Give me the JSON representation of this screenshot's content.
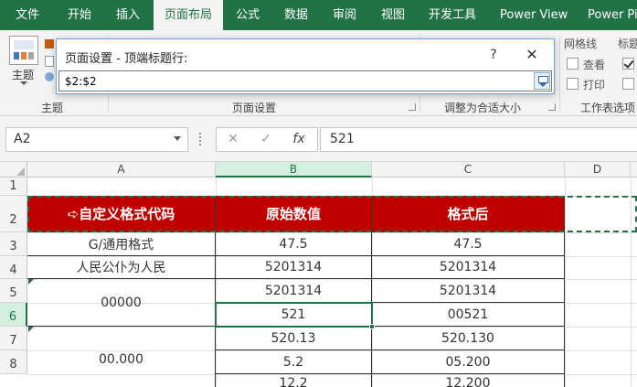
{
  "ribbon": {
    "tabs": [
      "文件",
      "开始",
      "插入",
      "页面布局",
      "公式",
      "数据",
      "审阅",
      "视图",
      "开发工具",
      "Power View",
      "Power Pi"
    ],
    "active_tab": "页面布局",
    "groups": {
      "theme": "主题",
      "theme_button": "主题",
      "page_setup": "页面设置",
      "scale_to_fit": "调整为合适大小",
      "sheet_options": "工作表选项"
    },
    "sheet_options": {
      "gridlines": "网格线",
      "headings": "标题",
      "view": "查看",
      "print": "打印"
    }
  },
  "dialog": {
    "title": "页面设置 - 顶端标题行:",
    "help": "?",
    "close": "✕",
    "value": "$2:$2"
  },
  "formula_bar": {
    "name_box": "A2",
    "cancel": "✕",
    "enter": "✓",
    "fx": "fx",
    "formula": "521"
  },
  "sheet": {
    "columns": [
      "A",
      "B",
      "C",
      "D"
    ],
    "rows": [
      "1",
      "2",
      "3",
      "4",
      "5",
      "6",
      "7",
      "8"
    ],
    "header": [
      "➪自定义格式代码",
      "原始数值",
      "格式后"
    ],
    "body": [
      [
        "G/通用格式",
        "47.5",
        "47.5"
      ],
      [
        "人民公仆为人民",
        "5201314",
        "5201314"
      ],
      [
        "00000",
        "5201314",
        "5201314"
      ],
      [
        "",
        "521",
        "00521"
      ],
      [
        "00.000",
        "520.13",
        "520.130"
      ],
      [
        "",
        "5.2",
        "05.200"
      ],
      [
        "",
        "12.2",
        "12.200"
      ]
    ],
    "colors": {
      "header_bg": "#c00000",
      "accent": "#217346"
    }
  }
}
